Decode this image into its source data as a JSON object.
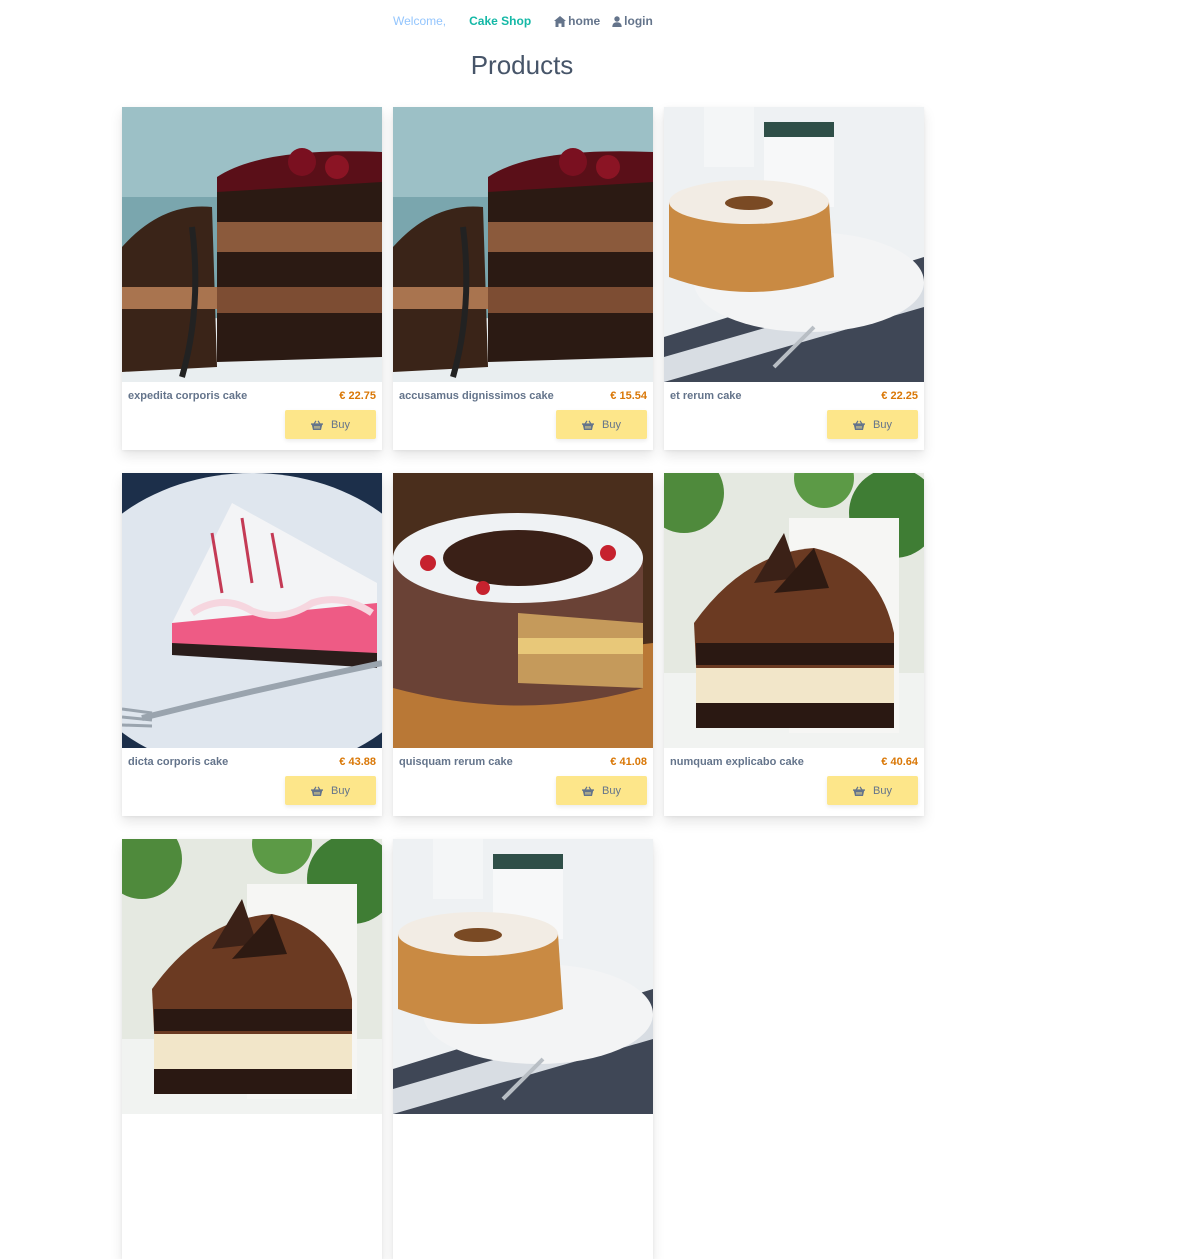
{
  "header": {
    "welcome": "Welcome,",
    "shop": "Cake Shop",
    "home": "home",
    "login": "login"
  },
  "page_title": "Products",
  "currency": "€",
  "buy_label": "Buy",
  "colors": {
    "accent": "#14b8a6",
    "button": "#fde68a",
    "price": "#d97706"
  },
  "products": [
    {
      "name": "expedita corporis cake",
      "price": "€ 22.75",
      "image": "layer-chocolate-cherry-cake"
    },
    {
      "name": "accusamus dignissimos cake",
      "price": "€ 15.54",
      "image": "layer-chocolate-cherry-cake"
    },
    {
      "name": "et rerum cake",
      "price": "€ 22.25",
      "image": "bundt-cake"
    },
    {
      "name": "dicta corporis cake",
      "price": "€ 43.88",
      "image": "raspberry-cheesecake-slice"
    },
    {
      "name": "quisquam rerum cake",
      "price": "€ 41.08",
      "image": "chocolate-strawberry-cake"
    },
    {
      "name": "numquam explicabo cake",
      "price": "€ 40.64",
      "image": "chocolate-mousse-slice"
    },
    {
      "image": "chocolate-mousse-slice"
    },
    {
      "image": "bundt-cake"
    }
  ]
}
